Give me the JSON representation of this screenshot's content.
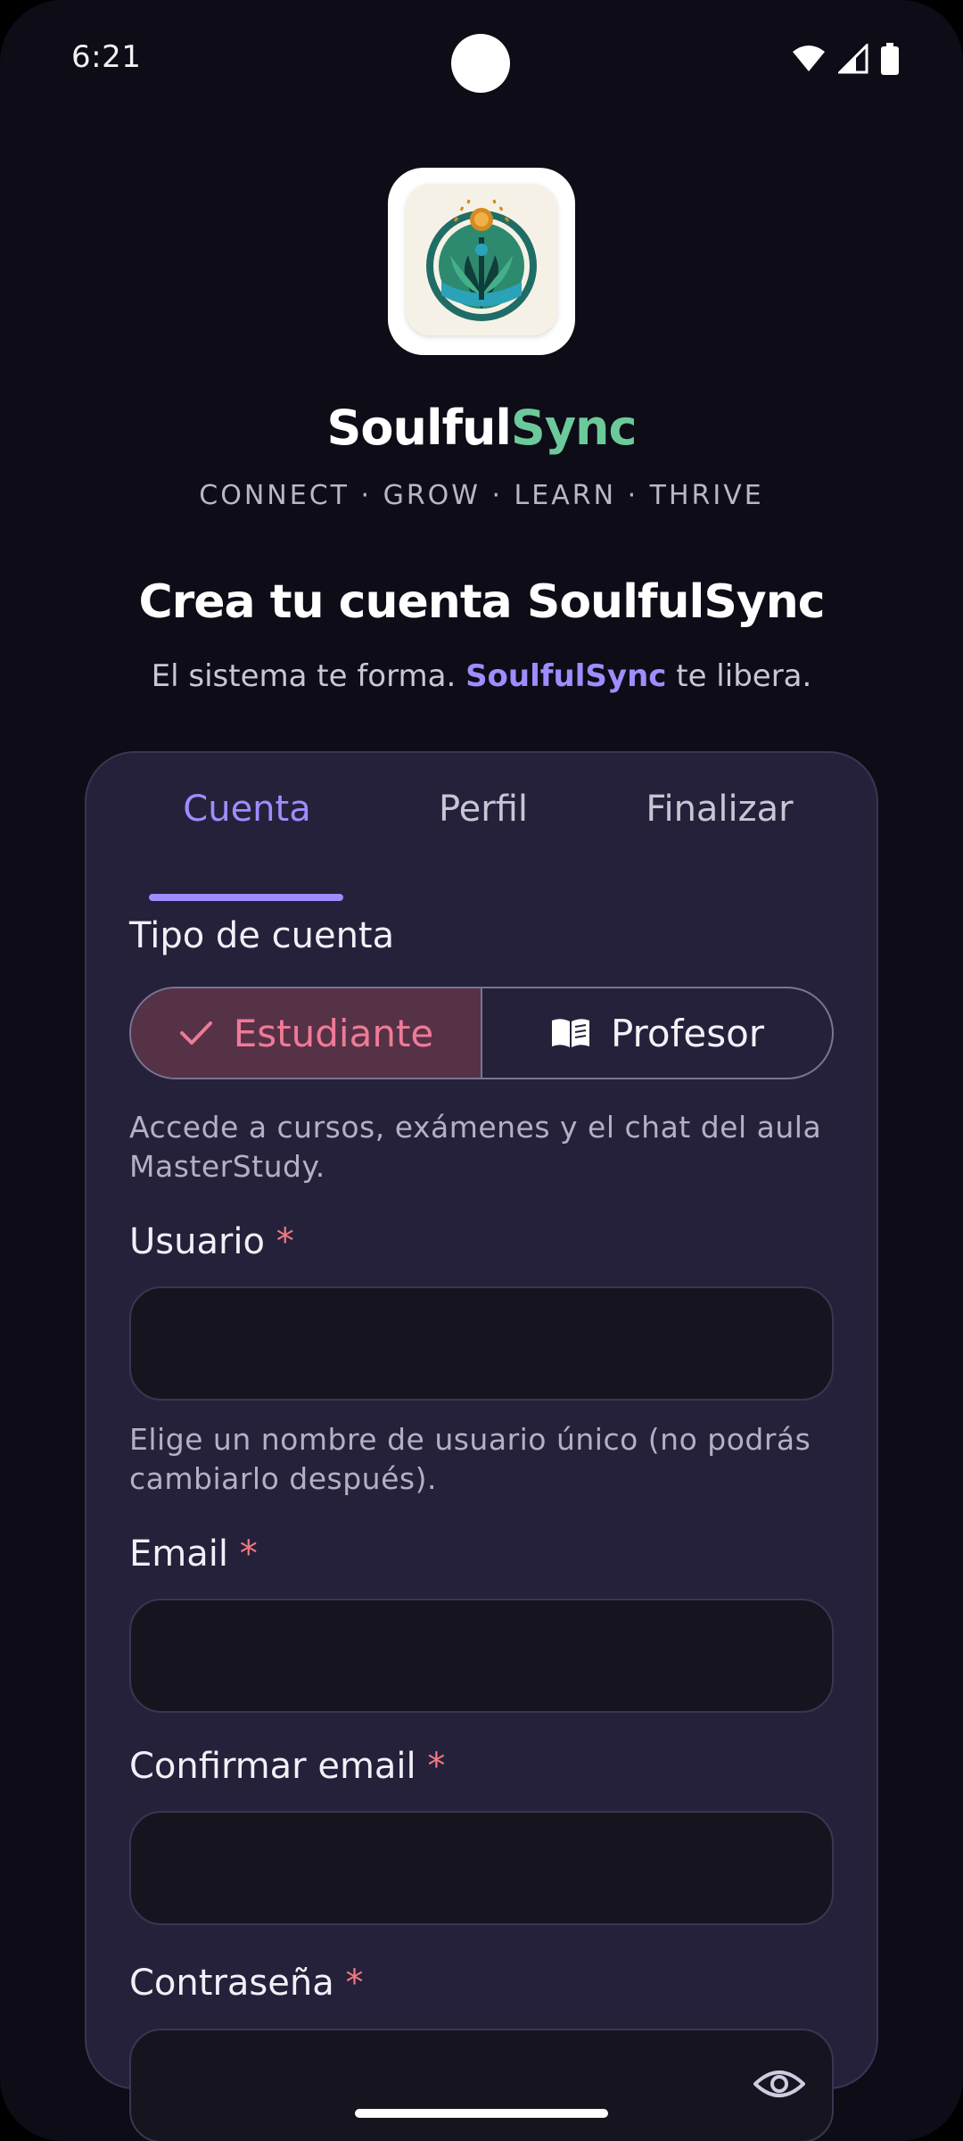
{
  "status_bar": {
    "time": "6:21"
  },
  "brand": {
    "name_part1": "Soulful",
    "name_part2": "Sync",
    "tagline": "CONNECT · GROW · LEARN · THRIVE"
  },
  "header": {
    "title": "Crea tu cuenta SoulfulSync",
    "subtitle_prefix": "El sistema te forma. ",
    "subtitle_highlight": "SoulfulSync",
    "subtitle_suffix": " te libera."
  },
  "tabs": [
    {
      "label": "Cuenta",
      "active": true
    },
    {
      "label": "Perfil",
      "active": false
    },
    {
      "label": "Finalizar",
      "active": false
    }
  ],
  "form": {
    "account_type_label": "Tipo de cuenta",
    "account_types": [
      {
        "label": "Estudiante",
        "icon": "check-icon",
        "selected": true
      },
      {
        "label": "Profesor",
        "icon": "book-icon",
        "selected": false
      }
    ],
    "account_type_helper": "Accede a cursos, exámenes y el chat del aula MasterStudy.",
    "required_mark": "*",
    "username": {
      "label": "Usuario",
      "value": "",
      "helper": "Elige un nombre de usuario único (no podrás cambiarlo después)."
    },
    "email": {
      "label": "Email",
      "value": ""
    },
    "confirm_email": {
      "label": "Confirmar email",
      "value": ""
    },
    "password": {
      "label": "Contraseña",
      "value": ""
    }
  },
  "colors": {
    "accent": "#a08cff",
    "brand_green": "#6cc99a",
    "required": "#f07880",
    "selected_segment": "#f07a96"
  }
}
